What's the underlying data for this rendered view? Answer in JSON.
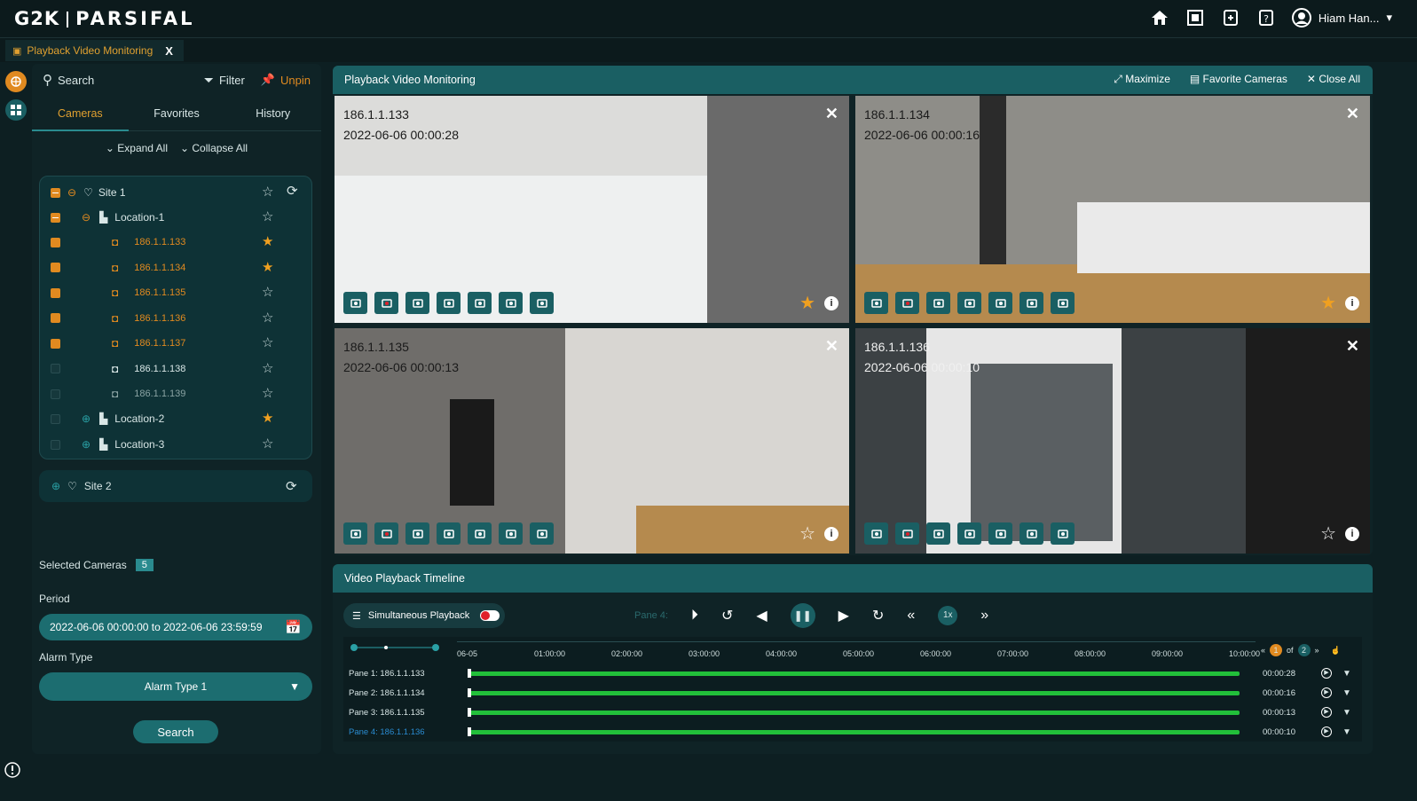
{
  "app": {
    "logo": "G2K",
    "product": "PARSIFAL",
    "user": "Hiam Han..."
  },
  "tab": {
    "title": "Playback Video Monitoring",
    "close": "X"
  },
  "sidebar": {
    "search": "Search",
    "filter": "Filter",
    "unpin": "Unpin",
    "tabs": [
      "Cameras",
      "Favorites",
      "History"
    ],
    "expand_all": "Expand All",
    "collapse_all": "Collapse All",
    "tree": {
      "site1": "Site 1",
      "location1": "Location-1",
      "cameras": [
        {
          "ip": "186.1.1.133",
          "checked": true,
          "fav": true
        },
        {
          "ip": "186.1.1.134",
          "checked": true,
          "fav": true
        },
        {
          "ip": "186.1.1.135",
          "checked": true,
          "fav": false
        },
        {
          "ip": "186.1.1.136",
          "checked": true,
          "fav": false
        },
        {
          "ip": "186.1.1.137",
          "checked": true,
          "fav": false
        },
        {
          "ip": "186.1.1.138",
          "checked": false,
          "fav": false
        },
        {
          "ip": "186.1.1.139",
          "checked": false,
          "fav": false
        }
      ],
      "location2": "Location-2",
      "location3": "Location-3",
      "site2": "Site 2"
    },
    "selected_cameras_label": "Selected Cameras",
    "selected_count": "5",
    "period_label": "Period",
    "period_value": "2022-06-06  00:00:00 to 2022-06-06 23:59:59",
    "alarm_type_label": "Alarm Type",
    "alarm_type_value": "Alarm Type 1",
    "search_button": "Search"
  },
  "panel": {
    "title": "Playback Video Monitoring",
    "maximize": "Maximize",
    "favorite_cameras": "Favorite Cameras",
    "close_all": "Close All",
    "panes": [
      {
        "ip": "186.1.1.133",
        "ts": "2022-06-06  00:00:28"
      },
      {
        "ip": "186.1.1.134",
        "ts": "2022-06-06  00:00:16"
      },
      {
        "ip": "186.1.1.135",
        "ts": "2022-06-06  00:00:13"
      },
      {
        "ip": "186.1.1.136",
        "ts": "2022-06-06  00:00:10"
      }
    ]
  },
  "timeline": {
    "title": "Video Playback Timeline",
    "simultaneous": "Simultaneous Playback",
    "active_pane": "Pane 4:",
    "speed": "1x",
    "ticks": [
      "06-05",
      "01:00:00",
      "02:00:00",
      "03:00:00",
      "04:00:00",
      "05:00:00",
      "06:00:00",
      "07:00:00",
      "08:00:00",
      "09:00:00",
      "10:00:00"
    ],
    "page": "1",
    "page_of": "of",
    "page_total": "2",
    "lanes": [
      {
        "name": "Pane 1:  186.1.1.133",
        "time": "00:00:28",
        "active": false
      },
      {
        "name": "Pane 2:  186.1.1.134",
        "time": "00:00:16",
        "active": false
      },
      {
        "name": "Pane 3:  186.1.1.135",
        "time": "00:00:13",
        "active": false
      },
      {
        "name": "Pane 4:  186.1.1.136",
        "time": "00:00:10",
        "active": true
      }
    ]
  },
  "colors": {
    "accent": "#1a5f63",
    "orange": "#e08a20",
    "green": "#22c03a"
  }
}
